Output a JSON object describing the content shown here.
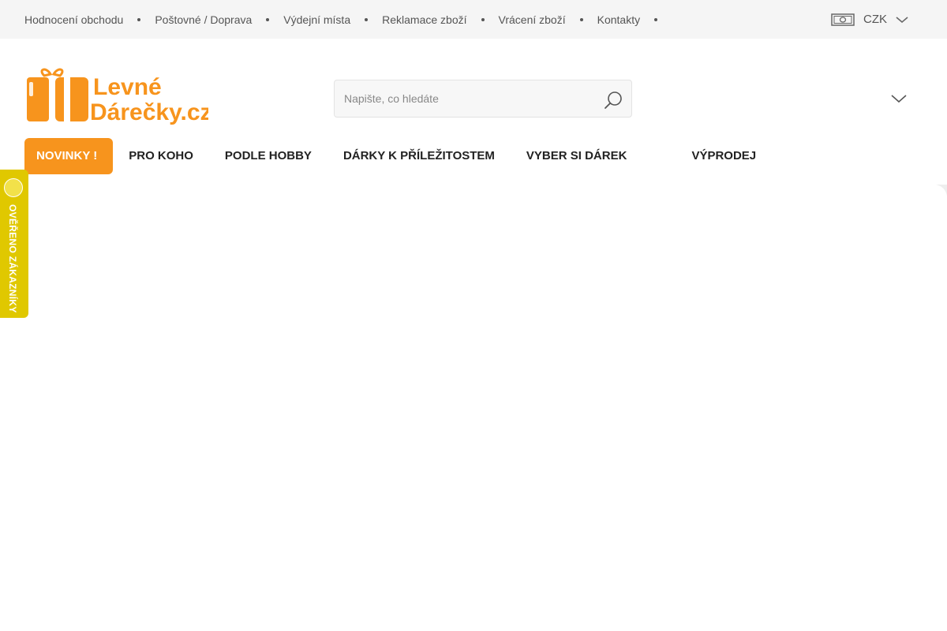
{
  "topbar": {
    "links": [
      "Hodnocení obchodu",
      "Poštovné / Doprava",
      "Výdejní místa",
      "Reklamace zboží",
      "Vrácení zboží",
      "Kontakty"
    ],
    "currency": "CZK"
  },
  "logo": {
    "line1": "Levné",
    "line2": "Dárečky.cz",
    "color": "#f7941d"
  },
  "search": {
    "placeholder": "Napište, co hledáte",
    "value": ""
  },
  "nav": {
    "items": [
      "NOVINKY !",
      "PRO KOHO",
      "PODLE HOBBY",
      "DÁRKY K PŘÍLEŽITOSTEM",
      "VYBER SI DÁREK",
      "VÝPRODEJ"
    ],
    "accent": "#f7941d"
  },
  "badge": {
    "label": "OVĚŘENO ZÁKAZNÍKY",
    "color": "#e0c800"
  },
  "icons": {
    "currency": "money-icon",
    "currency_toggle": "chevron-down-icon",
    "search": "search-icon",
    "account_toggle": "chevron-down-icon"
  }
}
